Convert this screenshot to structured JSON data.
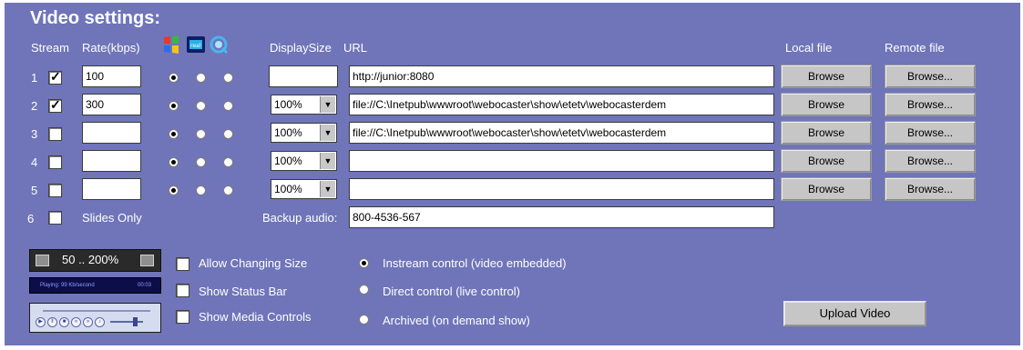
{
  "title": "Video settings:",
  "headers": {
    "stream": "Stream",
    "rate": "Rate(kbps)",
    "display_size": "DisplaySize",
    "url": "URL",
    "local_file": "Local file",
    "remote_file": "Remote file"
  },
  "player_icons": [
    "windows-media-icon",
    "real-player-icon",
    "quicktime-icon"
  ],
  "rows": [
    {
      "num": "1",
      "checked": true,
      "rate": "100",
      "radio": 0,
      "size": "",
      "url": "http://junior:8080",
      "browse_local": "Browse",
      "browse_remote": "Browse..."
    },
    {
      "num": "2",
      "checked": true,
      "rate": "300",
      "radio": 0,
      "size": "100%",
      "url": "file://C:\\Inetpub\\wwwroot\\webocaster\\show\\etetv\\webocasterdem",
      "browse_local": "Browse",
      "browse_remote": "Browse..."
    },
    {
      "num": "3",
      "checked": false,
      "rate": "",
      "radio": 0,
      "size": "100%",
      "url": "file://C:\\Inetpub\\wwwroot\\webocaster\\show\\etetv\\webocasterdem",
      "browse_local": "Browse",
      "browse_remote": "Browse..."
    },
    {
      "num": "4",
      "checked": false,
      "rate": "",
      "radio": 0,
      "size": "100%",
      "url": "",
      "browse_local": "Browse",
      "browse_remote": "Browse..."
    },
    {
      "num": "5",
      "checked": false,
      "rate": "",
      "radio": 0,
      "size": "100%",
      "url": "",
      "browse_local": "Browse",
      "browse_remote": "Browse..."
    }
  ],
  "row6": {
    "num": "6",
    "checked": false,
    "label": "Slides Only"
  },
  "backup_audio": {
    "label": "Backup audio:",
    "value": "800-4536-567"
  },
  "previews": {
    "size_range": "50 .. 200%",
    "status_text": "Playing: 99 Kb/second",
    "status_time": "00:03"
  },
  "options": [
    {
      "label": "Allow Changing Size",
      "checked": false
    },
    {
      "label": "Show Status Bar",
      "checked": false
    },
    {
      "label": "Show Media Controls",
      "checked": false
    }
  ],
  "control_modes": [
    {
      "label": "Instream control (video embedded)",
      "selected": true
    },
    {
      "label": "Direct control (live control)",
      "selected": false
    },
    {
      "label": "Archived (on demand show)",
      "selected": false
    }
  ],
  "upload_label": "Upload Video",
  "colors": {
    "panel": "#6f75b8",
    "label": "#ffffff"
  }
}
